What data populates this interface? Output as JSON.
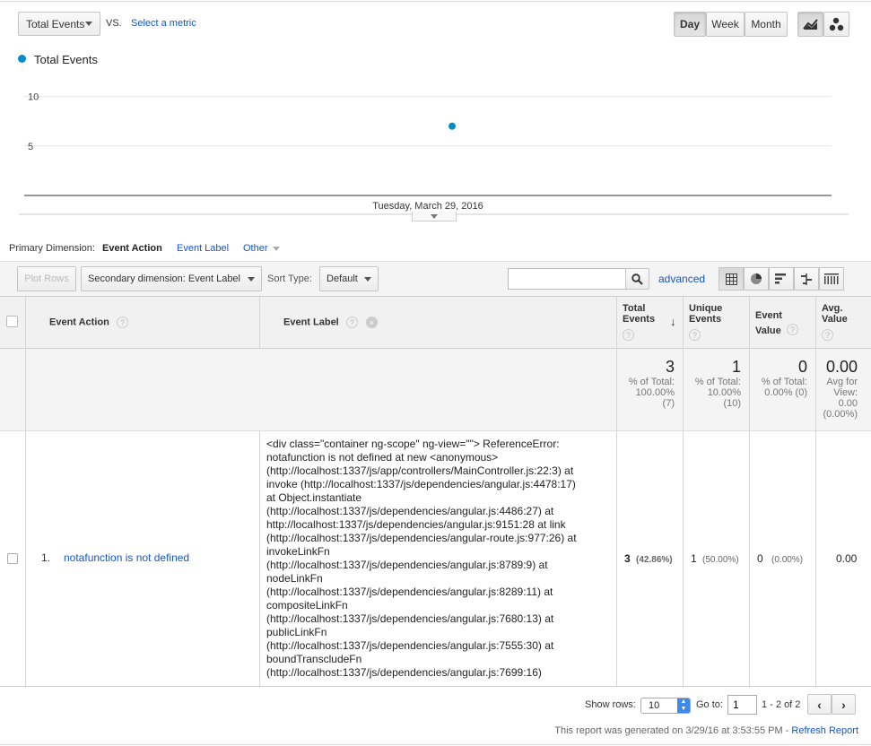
{
  "top_controls": {
    "metric_select": "Total Events",
    "vs_label": "VS.",
    "select_metric": "Select a metric",
    "period_buttons": [
      "Day",
      "Week",
      "Month"
    ],
    "active_period": "Day"
  },
  "legend": {
    "series_name": "Total Events",
    "color": "#058dc7"
  },
  "chart_data": {
    "type": "line",
    "title": "",
    "xlabel": "Tuesday, March 29, 2016",
    "ylabel": "",
    "y_ticks": [
      "10",
      "5"
    ],
    "ylim": [
      0,
      12.5
    ],
    "x": [
      "Tuesday, March 29, 2016"
    ],
    "series": [
      {
        "name": "Total Events",
        "values": [
          7
        ],
        "color": "#058dc7"
      }
    ]
  },
  "dimension_bar": {
    "label": "Primary Dimension:",
    "active": "Event Action",
    "options": [
      "Event Label",
      "Other"
    ]
  },
  "toolbar": {
    "plot_rows": "Plot Rows",
    "secondary_dimension": "Secondary dimension: Event Label",
    "sort_type_label": "Sort Type:",
    "sort_type_value": "Default",
    "search_value": "",
    "advanced": "advanced"
  },
  "table": {
    "headers": {
      "event_action": "Event Action",
      "event_label": "Event Label",
      "total_events": "Total Events",
      "unique_events": "Unique Events",
      "event_value": "Event Value",
      "avg_value": "Avg. Value"
    },
    "totals": {
      "total_events": {
        "value": "3",
        "sub": [
          "% of Total:",
          "100.00%",
          "(7)"
        ]
      },
      "unique_events": {
        "value": "1",
        "sub": [
          "% of Total:",
          "10.00%",
          "(10)"
        ]
      },
      "event_value": {
        "value": "0",
        "sub": [
          "% of Total:",
          "0.00% (0)"
        ]
      },
      "avg_value": {
        "value": "0.00",
        "sub": [
          "Avg for",
          "View:",
          "0.00",
          "(0.00%)"
        ]
      }
    },
    "rows": [
      {
        "index": "1.",
        "event_action": "notafunction is not defined",
        "event_label_lines": [
          "<div class=\"container ng-scope\" ng-view=\"\"> ReferenceError:",
          "notafunction is not defined at new <anonymous>",
          "(http://localhost:1337/js/app/controllers/MainController.js:22:3) at",
          "invoke (http://localhost:1337/js/dependencies/angular.js:4478:17)",
          "at Object.instantiate",
          "(http://localhost:1337/js/dependencies/angular.js:4486:27) at",
          "http://localhost:1337/js/dependencies/angular.js:9151:28 at link",
          "(http://localhost:1337/js/dependencies/angular-route.js:977:26) at",
          "invokeLinkFn",
          "(http://localhost:1337/js/dependencies/angular.js:8789:9) at",
          "nodeLinkFn",
          "(http://localhost:1337/js/dependencies/angular.js:8289:11) at",
          "compositeLinkFn",
          "(http://localhost:1337/js/dependencies/angular.js:7680:13) at",
          "publicLinkFn",
          "(http://localhost:1337/js/dependencies/angular.js:7555:30) at",
          "boundTranscludeFn",
          "(http://localhost:1337/js/dependencies/angular.js:7699:16)"
        ],
        "total_events": "3",
        "total_events_pct": "(42.86%)",
        "unique_events": "1",
        "unique_events_pct": "(50.00%)",
        "event_value": "0",
        "event_value_pct": "(0.00%)",
        "avg_value": "0.00"
      }
    ]
  },
  "pagination": {
    "show_rows_label": "Show rows:",
    "show_rows_value": "10",
    "go_to_label": "Go to:",
    "go_to_value": "1",
    "range": "1 - 2 of 2"
  },
  "footer": {
    "generated_text": "This report was generated on 3/29/16 at 3:53:55 PM - ",
    "refresh": "Refresh Report"
  }
}
